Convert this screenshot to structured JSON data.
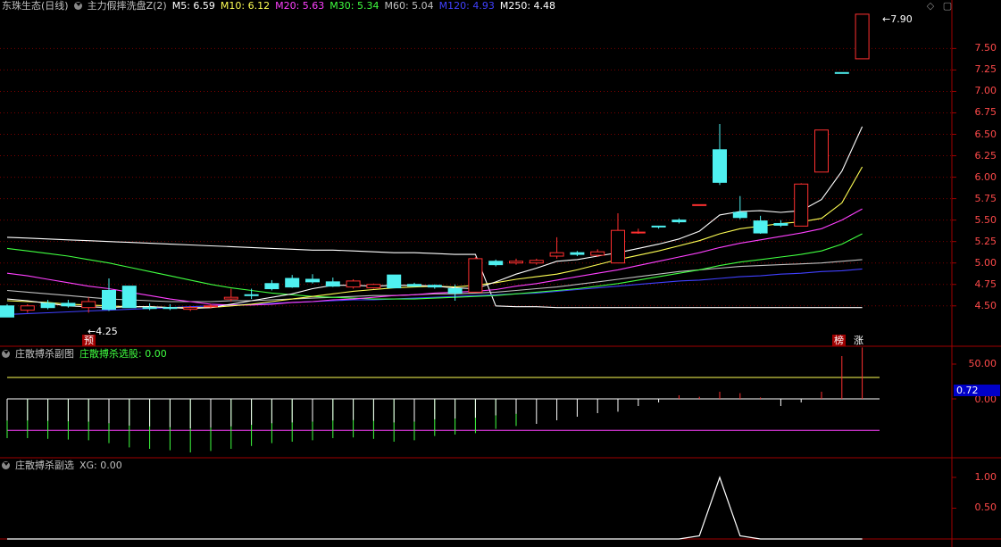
{
  "colors": {
    "background": "#000000",
    "grid": "#7a0000",
    "up": "#ff3030",
    "down": "#4ff0f0",
    "axis_text": "#ff4a4a",
    "ma5": "#ffffff",
    "ma10": "#ffff54",
    "ma20": "#ff40ff",
    "ma30": "#40ff40",
    "ma60": "#c0c0c0",
    "ma120": "#4040ff",
    "ma250": "#ffffff"
  },
  "main_panel": {
    "stock": "东珠生态(日线)",
    "indicator_name": "主力假摔洗盘Z(2)",
    "ma_items": [
      {
        "label": "M5: 6.59",
        "color": "#ffffff"
      },
      {
        "label": "M10: 6.12",
        "color": "#ffff54"
      },
      {
        "label": "M20: 5.63",
        "color": "#ff40ff"
      },
      {
        "label": "M30: 5.34",
        "color": "#40ff40"
      },
      {
        "label": "M60: 5.04",
        "color": "#c0c0c0"
      },
      {
        "label": "M120: 4.93",
        "color": "#4040ff"
      },
      {
        "label": "M250: 4.48",
        "color": "#ffffff"
      }
    ],
    "y_ticks": [
      "7.50",
      "7.25",
      "7.00",
      "6.75",
      "6.50",
      "6.25",
      "6.00",
      "5.75",
      "5.50",
      "5.25",
      "5.00",
      "4.75",
      "4.50"
    ],
    "high_label": "7.90",
    "low_label": "4.25",
    "signals": {
      "yu": "预",
      "bang": "榜",
      "zhang": "涨"
    }
  },
  "sub_panel1": {
    "title": "庄散搏杀副图",
    "xuangu_label": "庄散搏杀选股: 0.00",
    "y_ticks": [
      "50.00",
      "0.00"
    ],
    "current_value": "0.72"
  },
  "sub_panel2": {
    "title": "庄散搏杀副选",
    "xg_label": "XG: 0.00",
    "y_ticks": [
      "1.00",
      "0.50"
    ]
  },
  "chart_data": {
    "type": "candlestick",
    "note_candles": "open, high, low, close in price units",
    "y_range": [
      4.25,
      7.92
    ],
    "candles": [
      [
        4.5,
        4.52,
        4.37,
        4.37
      ],
      [
        4.45,
        4.52,
        4.42,
        4.5
      ],
      [
        4.53,
        4.57,
        4.46,
        4.48
      ],
      [
        4.53,
        4.57,
        4.48,
        4.5
      ],
      [
        4.48,
        4.6,
        4.42,
        4.55
      ],
      [
        4.68,
        4.82,
        4.44,
        4.46
      ],
      [
        4.73,
        4.73,
        4.5,
        4.48
      ],
      [
        4.48,
        4.53,
        4.45,
        4.47
      ],
      [
        4.48,
        4.52,
        4.45,
        4.47
      ],
      [
        4.46,
        4.5,
        4.44,
        4.48
      ],
      [
        4.49,
        4.52,
        4.47,
        4.5
      ],
      [
        4.58,
        4.7,
        4.55,
        4.6
      ],
      [
        4.63,
        4.7,
        4.58,
        4.62
      ],
      [
        4.76,
        4.8,
        4.68,
        4.7
      ],
      [
        4.82,
        4.86,
        4.71,
        4.72
      ],
      [
        4.81,
        4.87,
        4.76,
        4.78
      ],
      [
        4.78,
        4.83,
        4.72,
        4.73
      ],
      [
        4.72,
        4.81,
        4.7,
        4.79
      ],
      [
        4.71,
        4.76,
        4.7,
        4.75
      ],
      [
        4.86,
        4.86,
        4.71,
        4.71
      ],
      [
        4.75,
        4.77,
        4.72,
        4.73
      ],
      [
        4.74,
        4.75,
        4.7,
        4.72
      ],
      [
        4.7,
        4.75,
        4.56,
        4.65
      ],
      [
        4.66,
        5.07,
        4.66,
        5.05
      ],
      [
        5.02,
        5.04,
        4.96,
        4.98
      ],
      [
        5.0,
        5.05,
        4.98,
        5.02
      ],
      [
        5.0,
        5.05,
        4.98,
        5.03
      ],
      [
        5.08,
        5.3,
        5.05,
        5.12
      ],
      [
        5.12,
        5.14,
        5.08,
        5.1
      ],
      [
        5.09,
        5.16,
        5.07,
        5.13
      ],
      [
        5.0,
        5.58,
        5.0,
        5.38
      ],
      [
        5.36,
        5.4,
        5.34,
        5.36
      ],
      [
        5.43,
        5.43,
        5.4,
        5.42
      ],
      [
        5.5,
        5.52,
        5.46,
        5.48
      ],
      [
        5.68,
        5.68,
        5.68,
        5.68
      ],
      [
        6.32,
        6.62,
        5.91,
        5.94
      ],
      [
        5.59,
        5.78,
        5.51,
        5.53
      ],
      [
        5.49,
        5.55,
        5.34,
        5.35
      ],
      [
        5.46,
        5.5,
        5.42,
        5.44
      ],
      [
        5.43,
        5.93,
        5.43,
        5.92
      ],
      [
        6.06,
        6.55,
        6.06,
        6.55
      ],
      [
        7.22,
        7.22,
        7.21,
        7.21
      ],
      [
        7.38,
        7.9,
        7.38,
        7.9
      ]
    ],
    "ma5": [
      4.58,
      4.56,
      4.53,
      4.5,
      4.49,
      4.48,
      4.49,
      4.49,
      4.48,
      4.47,
      4.48,
      4.52,
      4.56,
      4.6,
      4.64,
      4.7,
      4.74,
      4.74,
      4.73,
      4.74,
      4.74,
      4.73,
      4.71,
      4.7,
      4.78,
      4.87,
      4.94,
      5.02,
      5.04,
      5.08,
      5.12,
      5.17,
      5.22,
      5.28,
      5.37,
      5.56,
      5.6,
      5.61,
      5.59,
      5.61,
      5.74,
      6.07,
      6.59
    ],
    "ma10": [
      4.56,
      4.55,
      4.54,
      4.52,
      4.51,
      4.5,
      4.49,
      4.49,
      4.48,
      4.48,
      4.48,
      4.5,
      4.52,
      4.55,
      4.58,
      4.61,
      4.64,
      4.67,
      4.69,
      4.71,
      4.72,
      4.73,
      4.72,
      4.74,
      4.77,
      4.81,
      4.84,
      4.87,
      4.92,
      4.98,
      5.04,
      5.09,
      5.14,
      5.2,
      5.26,
      5.34,
      5.4,
      5.43,
      5.46,
      5.48,
      5.52,
      5.7,
      6.12
    ],
    "ma20": [
      4.88,
      4.85,
      4.81,
      4.77,
      4.73,
      4.7,
      4.66,
      4.62,
      4.58,
      4.55,
      4.52,
      4.51,
      4.51,
      4.52,
      4.54,
      4.55,
      4.57,
      4.58,
      4.6,
      4.62,
      4.63,
      4.65,
      4.66,
      4.67,
      4.69,
      4.73,
      4.76,
      4.8,
      4.84,
      4.88,
      4.92,
      4.97,
      5.02,
      5.07,
      5.12,
      5.18,
      5.23,
      5.27,
      5.31,
      5.35,
      5.4,
      5.5,
      5.63
    ],
    "ma30": [
      5.17,
      5.14,
      5.11,
      5.08,
      5.04,
      5.0,
      4.95,
      4.9,
      4.85,
      4.8,
      4.75,
      4.71,
      4.68,
      4.65,
      4.63,
      4.61,
      4.6,
      4.59,
      4.58,
      4.58,
      4.58,
      4.59,
      4.6,
      4.61,
      4.62,
      4.64,
      4.66,
      4.68,
      4.7,
      4.73,
      4.76,
      4.8,
      4.84,
      4.88,
      4.92,
      4.97,
      5.01,
      5.04,
      5.07,
      5.1,
      5.14,
      5.22,
      5.34
    ],
    "ma60": [
      4.68,
      4.66,
      4.64,
      4.62,
      4.6,
      4.58,
      4.57,
      4.56,
      4.55,
      4.55,
      4.55,
      4.56,
      4.56,
      4.57,
      4.58,
      4.59,
      4.6,
      4.61,
      4.62,
      4.62,
      4.63,
      4.64,
      4.64,
      4.65,
      4.66,
      4.68,
      4.7,
      4.72,
      4.75,
      4.78,
      4.81,
      4.84,
      4.87,
      4.9,
      4.92,
      4.94,
      4.96,
      4.97,
      4.98,
      4.99,
      5.0,
      5.02,
      5.04
    ],
    "ma120": [
      4.4,
      4.41,
      4.42,
      4.43,
      4.44,
      4.45,
      4.46,
      4.47,
      4.48,
      4.49,
      4.5,
      4.51,
      4.52,
      4.53,
      4.54,
      4.55,
      4.56,
      4.57,
      4.57,
      4.58,
      4.59,
      4.6,
      4.61,
      4.62,
      4.63,
      4.64,
      4.65,
      4.67,
      4.69,
      4.71,
      4.73,
      4.75,
      4.77,
      4.79,
      4.8,
      4.82,
      4.84,
      4.85,
      4.87,
      4.88,
      4.9,
      4.91,
      4.93
    ],
    "ma250": [
      5.3,
      5.29,
      5.28,
      5.27,
      5.26,
      5.25,
      5.24,
      5.23,
      5.22,
      5.21,
      5.2,
      5.19,
      5.18,
      5.17,
      5.16,
      5.15,
      5.15,
      5.14,
      5.13,
      5.12,
      5.12,
      5.11,
      5.1,
      5.1,
      4.5,
      4.49,
      4.49,
      4.48,
      4.48,
      4.48,
      4.48,
      4.48,
      4.48,
      4.48,
      4.48,
      4.48,
      4.48,
      4.48,
      4.48,
      4.48,
      4.48,
      4.48,
      4.48
    ],
    "sub1_bars": [
      -55,
      -55,
      -56,
      -57,
      -58,
      -62,
      -68,
      -70,
      -72,
      -75,
      -73,
      -70,
      -66,
      -62,
      -60,
      -58,
      -55,
      -54,
      -56,
      -60,
      -58,
      -52,
      -50,
      -48,
      -42,
      -38,
      -35,
      -30,
      -25,
      -20,
      -18,
      -10,
      -5,
      5,
      3,
      10,
      8,
      2,
      -10,
      -5,
      10,
      60,
      72
    ],
    "sub1_lines": {
      "upper": 30,
      "zero": 0,
      "lower": -44
    },
    "sub2_xg": [
      0,
      0,
      0,
      0,
      0,
      0,
      0,
      0,
      0,
      0,
      0,
      0,
      0,
      0,
      0,
      0,
      0,
      0,
      0,
      0,
      0,
      0,
      0,
      0,
      0,
      0,
      0,
      0,
      0,
      0,
      0,
      0,
      0,
      0,
      0.05,
      1,
      0.05,
      0,
      0,
      0,
      0,
      0,
      0
    ]
  }
}
